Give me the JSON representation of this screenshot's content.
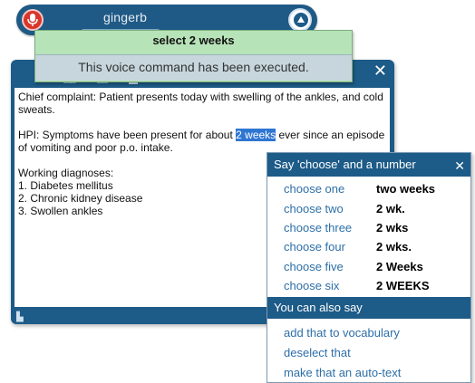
{
  "topbar": {
    "user": "gingerb"
  },
  "recognition": {
    "heard": "select 2 weeks",
    "message": "This voice command has been executed."
  },
  "dictation": {
    "chief_complaint": "Chief complaint: Patient presents today with swelling of the ankles, and cold sweats.",
    "hpi_before": "HPI: Symptoms have been present for about ",
    "hpi_selected": "2 weeks",
    "hpi_after": " ever since an episode of vomiting and poor p.o. intake.",
    "diagnoses_heading": "Working diagnoses:",
    "diagnoses": [
      "1.  Diabetes mellitus",
      "2.  Chronic kidney disease",
      "3.  Swollen ankles"
    ],
    "close_label": "✕"
  },
  "correction_menu": {
    "title": "Say 'choose' and a number",
    "close_label": "✕",
    "choices": [
      {
        "command": "choose one",
        "value": "two weeks"
      },
      {
        "command": "choose two",
        "value": "2 wk."
      },
      {
        "command": "choose three",
        "value": "2 wks"
      },
      {
        "command": "choose four",
        "value": "2 wks."
      },
      {
        "command": "choose five",
        "value": "2 Weeks"
      },
      {
        "command": "choose six",
        "value": "2 WEEKS"
      }
    ],
    "also_title": "You can also say",
    "also_items": [
      "add that to vocabulary",
      "deselect that",
      "make that an auto-text"
    ]
  },
  "colors": {
    "window_blue": "#1d5b88",
    "recognition_green": "#b7e3b8",
    "selection_blue": "#2f76d2",
    "mic_red": "#d9352b",
    "link_blue": "#2d6fa8"
  },
  "icons": [
    "microphone-icon",
    "help-icon",
    "transfer-icon",
    "save-icon",
    "trash-icon",
    "resize-grip-icon"
  ]
}
